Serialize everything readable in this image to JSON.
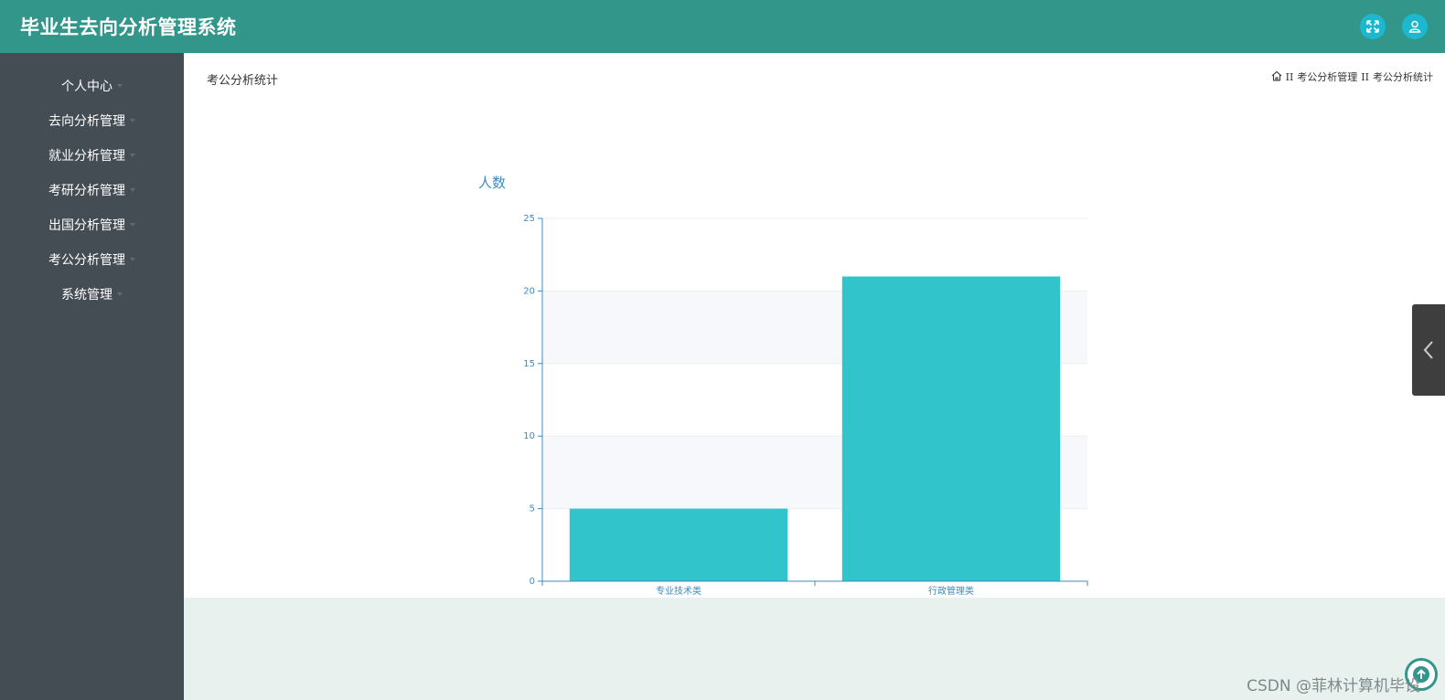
{
  "app": {
    "title": "毕业生去向分析管理系统",
    "header_color": "#33968a",
    "accent_color": "#1bb8cf"
  },
  "header_icons": [
    {
      "icon": "fullscreen-icon"
    },
    {
      "icon": "user-icon"
    }
  ],
  "sidebar": {
    "items": [
      {
        "label": "个人中心"
      },
      {
        "label": "去向分析管理"
      },
      {
        "label": "就业分析管理"
      },
      {
        "label": "考研分析管理"
      },
      {
        "label": "出国分析管理"
      },
      {
        "label": "考公分析管理"
      },
      {
        "label": "系统管理"
      }
    ]
  },
  "page": {
    "title": "考公分析统计",
    "breadcrumb": {
      "home_icon": "home-icon",
      "separator": "II",
      "items": [
        "考公分析管理",
        "考公分析统计"
      ]
    }
  },
  "chart_data": {
    "type": "bar",
    "title": "",
    "ylabel": "人数",
    "xlabel": "",
    "categories": [
      "专业技术类",
      "行政管理类"
    ],
    "values": [
      5,
      21
    ],
    "ylim": [
      0,
      25
    ],
    "yticks": [
      0,
      5,
      10,
      15,
      20,
      25
    ],
    "bar_color": "#31c5cb",
    "axis_color": "#3a8cc3",
    "grid": true,
    "split_area": true
  },
  "watermark": "CSDN @菲林计算机毕设"
}
